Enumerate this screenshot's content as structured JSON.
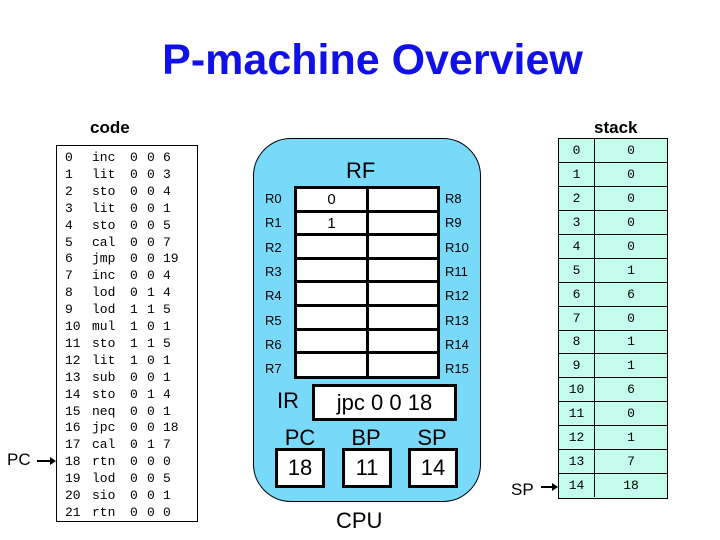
{
  "title": "P-machine Overview",
  "code": {
    "label": "code",
    "rows": [
      {
        "idx": "0",
        "op": "inc",
        "l": "0",
        "m": "0",
        "a": "6"
      },
      {
        "idx": "1",
        "op": "lit",
        "l": "0",
        "m": "0",
        "a": "3"
      },
      {
        "idx": "2",
        "op": "sto",
        "l": "0",
        "m": "0",
        "a": "4"
      },
      {
        "idx": "3",
        "op": "lit",
        "l": "0",
        "m": "0",
        "a": "1"
      },
      {
        "idx": "4",
        "op": "sto",
        "l": "0",
        "m": "0",
        "a": "5"
      },
      {
        "idx": "5",
        "op": "cal",
        "l": "0",
        "m": "0",
        "a": "7"
      },
      {
        "idx": "6",
        "op": "jmp",
        "l": "0",
        "m": "0",
        "a": "19"
      },
      {
        "idx": "7",
        "op": "inc",
        "l": "0",
        "m": "0",
        "a": "4"
      },
      {
        "idx": "8",
        "op": "lod",
        "l": "0",
        "m": "1",
        "a": "4"
      },
      {
        "idx": "9",
        "op": "lod",
        "l": "1",
        "m": "1",
        "a": "5"
      },
      {
        "idx": "10",
        "op": "mul",
        "l": "1",
        "m": "0",
        "a": "1"
      },
      {
        "idx": "11",
        "op": "sto",
        "l": "1",
        "m": "1",
        "a": "5"
      },
      {
        "idx": "12",
        "op": "lit",
        "l": "1",
        "m": "0",
        "a": "1"
      },
      {
        "idx": "13",
        "op": "sub",
        "l": "0",
        "m": "0",
        "a": "1"
      },
      {
        "idx": "14",
        "op": "sto",
        "l": "0",
        "m": "1",
        "a": "4"
      },
      {
        "idx": "15",
        "op": "neq",
        "l": "0",
        "m": "0",
        "a": "1"
      },
      {
        "idx": "16",
        "op": "jpc",
        "l": "0",
        "m": "0",
        "a": "18"
      },
      {
        "idx": "17",
        "op": "cal",
        "l": "0",
        "m": "1",
        "a": "7"
      },
      {
        "idx": "18",
        "op": "rtn",
        "l": "0",
        "m": "0",
        "a": "0"
      },
      {
        "idx": "19",
        "op": "lod",
        "l": "0",
        "m": "0",
        "a": "5"
      },
      {
        "idx": "20",
        "op": "sio",
        "l": "0",
        "m": "0",
        "a": "1"
      },
      {
        "idx": "21",
        "op": "rtn",
        "l": "0",
        "m": "0",
        "a": "0"
      }
    ],
    "pointer": {
      "label": "PC",
      "target_row": 18
    }
  },
  "cpu": {
    "label": "CPU",
    "rf": {
      "label": "RF",
      "left_labels": [
        "R0",
        "R1",
        "R2",
        "R3",
        "R4",
        "R5",
        "R6",
        "R7"
      ],
      "right_labels": [
        "R8",
        "R9",
        "R10",
        "R11",
        "R12",
        "R13",
        "R14",
        "R15"
      ],
      "left_values": [
        "0",
        "1",
        "",
        "",
        "",
        "",
        "",
        ""
      ],
      "right_values": [
        "",
        "",
        "",
        "",
        "",
        "",
        "",
        ""
      ]
    },
    "ir": {
      "label": "IR",
      "value": "jpc 0 0 18"
    },
    "pc": {
      "label": "PC",
      "value": "18"
    },
    "bp": {
      "label": "BP",
      "value": "11"
    },
    "sp": {
      "label": "SP",
      "value": "14"
    }
  },
  "stack": {
    "label": "stack",
    "rows": [
      {
        "idx": "0",
        "val": "0"
      },
      {
        "idx": "1",
        "val": "0"
      },
      {
        "idx": "2",
        "val": "0"
      },
      {
        "idx": "3",
        "val": "0"
      },
      {
        "idx": "4",
        "val": "0"
      },
      {
        "idx": "5",
        "val": "1"
      },
      {
        "idx": "6",
        "val": "6"
      },
      {
        "idx": "7",
        "val": "0"
      },
      {
        "idx": "8",
        "val": "1"
      },
      {
        "idx": "9",
        "val": "1"
      },
      {
        "idx": "10",
        "val": "6"
      },
      {
        "idx": "11",
        "val": "0"
      },
      {
        "idx": "12",
        "val": "1"
      },
      {
        "idx": "13",
        "val": "7"
      },
      {
        "idx": "14",
        "val": "18"
      }
    ],
    "pointer": {
      "label": "SP",
      "target_row": 14
    }
  },
  "colors": {
    "title": "#1010e8",
    "cpu_fill": "#79d9f9",
    "stack_fill": "#c4fcec"
  }
}
